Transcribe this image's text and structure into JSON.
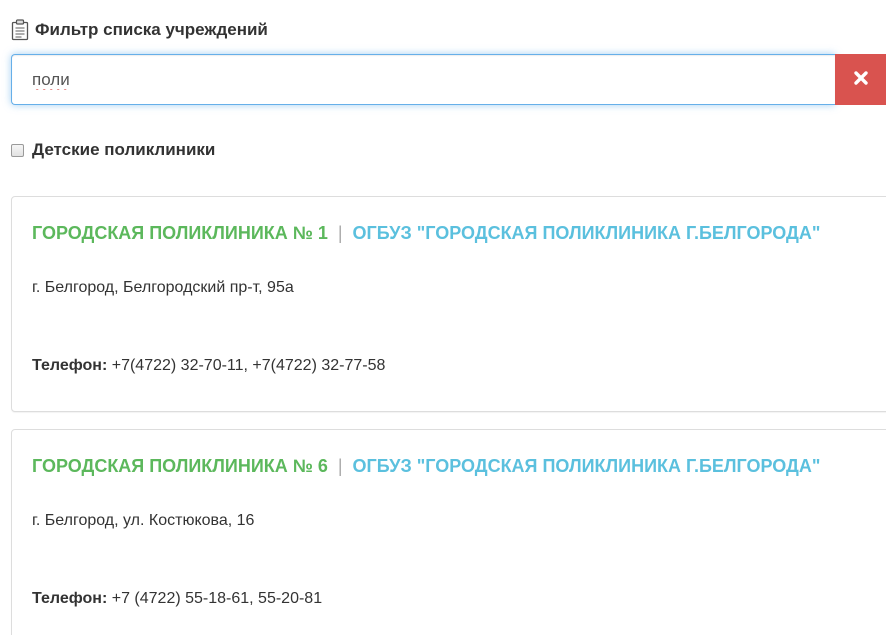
{
  "filter": {
    "title": "Фильтр списка учреждений",
    "search_value": "поли",
    "clear_label": "×"
  },
  "checkbox": {
    "label": "Детские поликлиники",
    "checked": false
  },
  "cards": [
    {
      "short_name": "ГОРОДСКАЯ ПОЛИКЛИНИКА № 1",
      "separator": "|",
      "full_name": "ОГБУЗ \"ГОРОДСКАЯ ПОЛИКЛИНИКА Г.БЕЛГОРОДА\"",
      "address": "г. Белгород, Белгородский пр-т, 95а",
      "phone_label": "Телефон:",
      "phone_value": " +7(4722) 32-70-11, +7(4722) 32-77-58"
    },
    {
      "short_name": "ГОРОДСКАЯ ПОЛИКЛИНИКА № 6",
      "separator": "|",
      "full_name": "ОГБУЗ \"ГОРОДСКАЯ ПОЛИКЛИНИКА Г.БЕЛГОРОДА\"",
      "address": "г. Белгород, ул. Костюкова, 16",
      "phone_label": "Телефон:",
      "phone_value": " +7 (4722) 55-18-61, 55-20-81"
    }
  ],
  "colors": {
    "short_name": "#5cb85c",
    "full_name": "#5bc0de",
    "danger": "#d9534f",
    "focus_border": "#66afe9"
  },
  "icons": {
    "filter_title": "clipboard-icon",
    "clear": "close-icon"
  }
}
